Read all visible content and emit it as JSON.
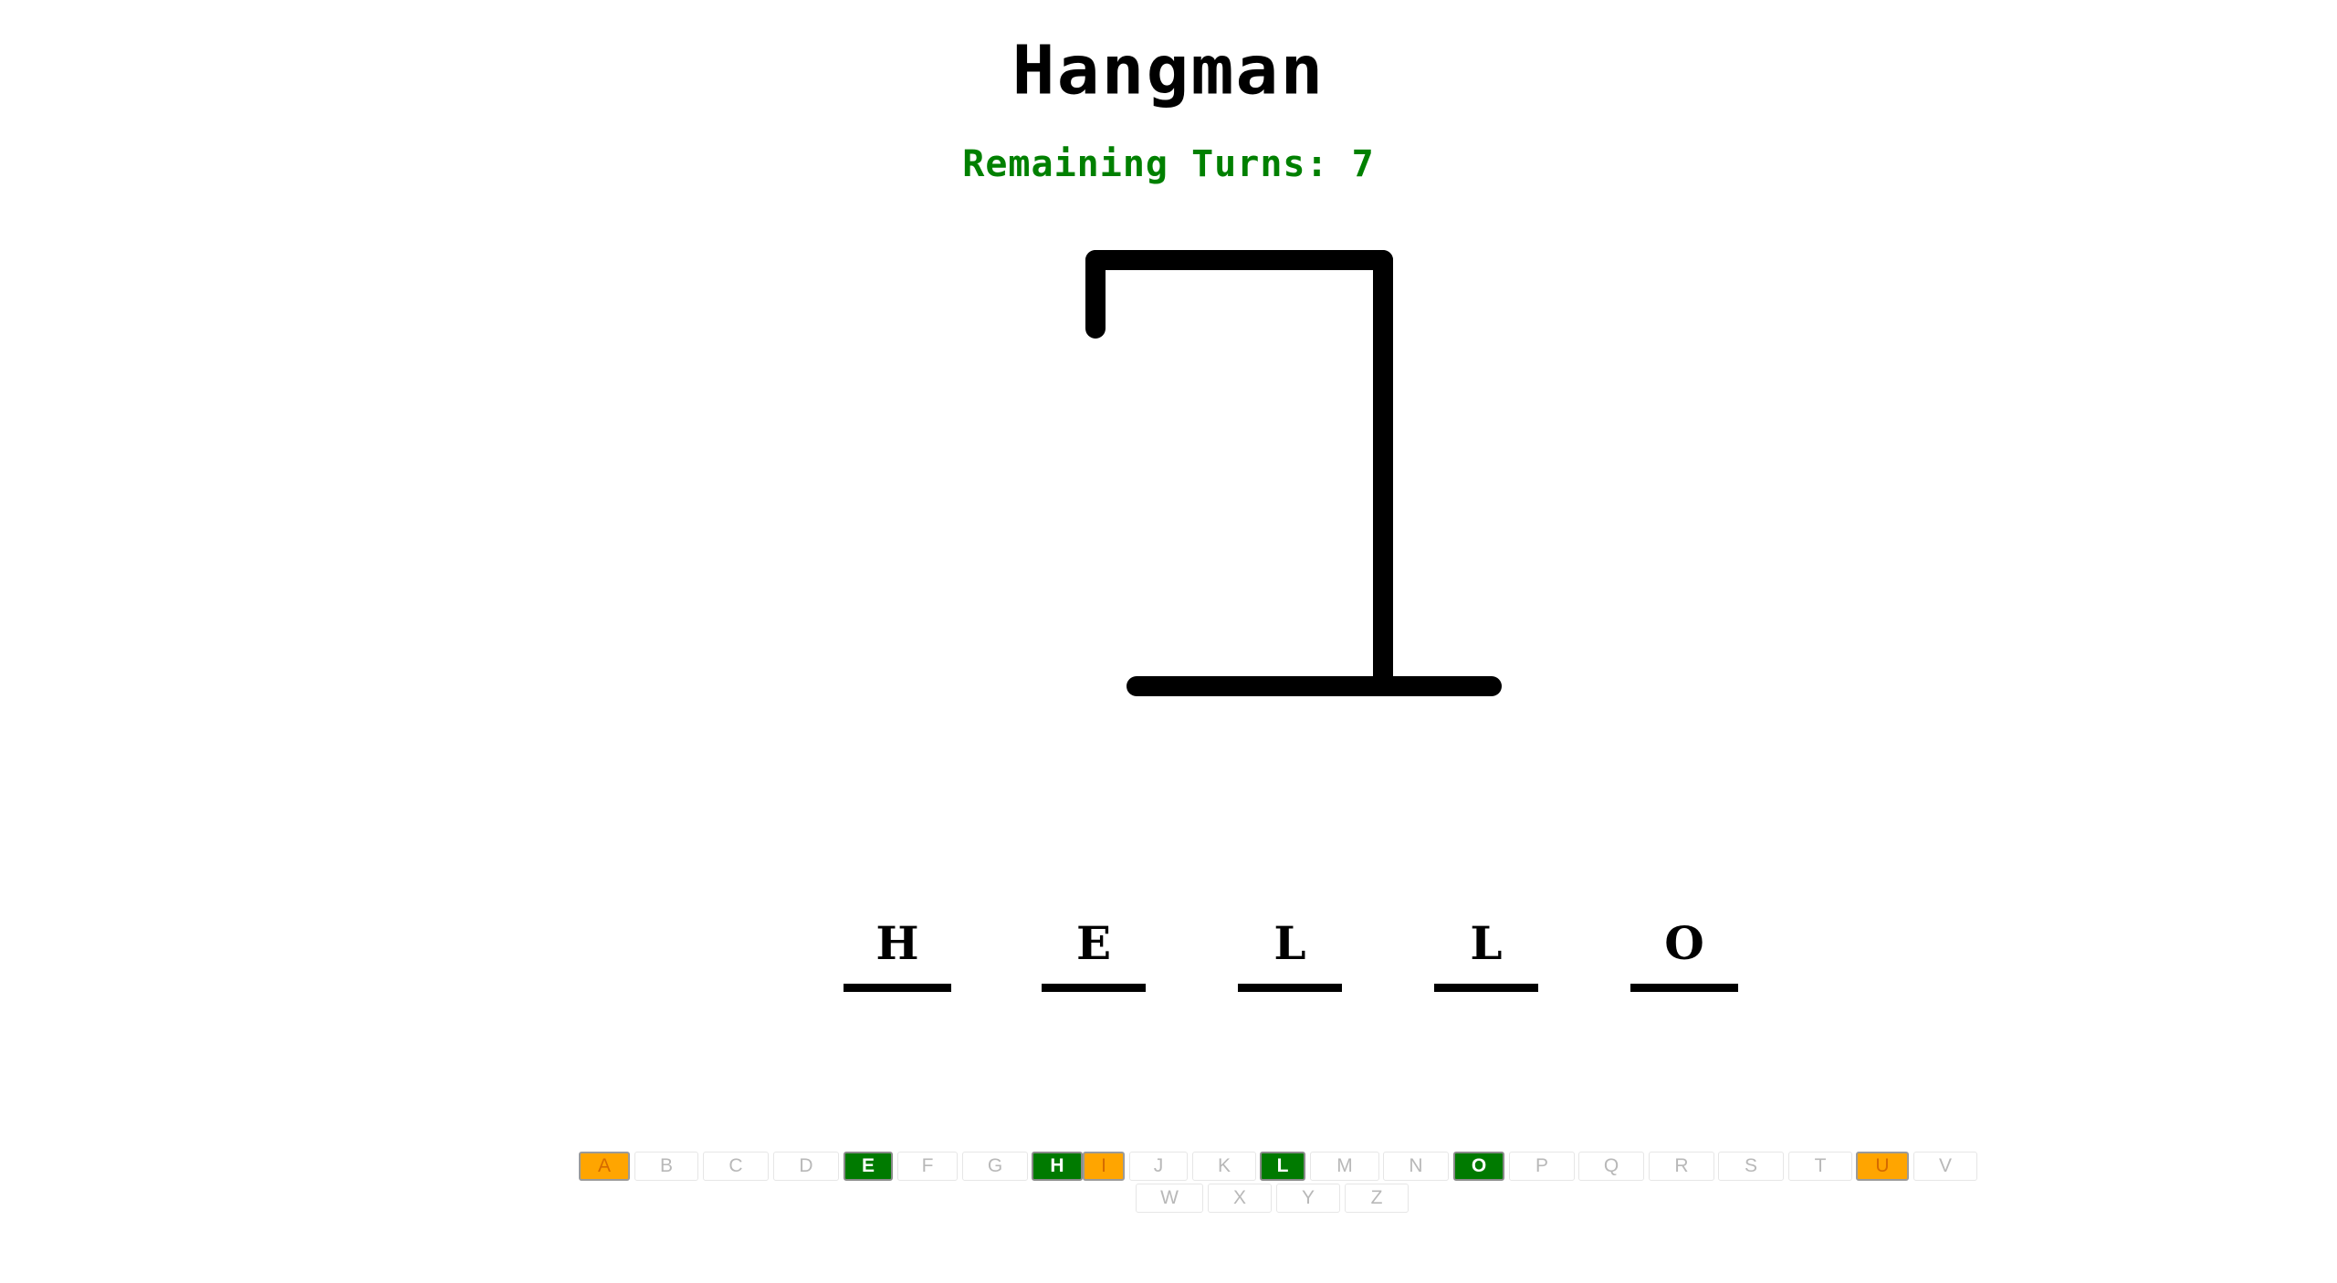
{
  "game": {
    "title": "Hangman",
    "remaining_turns_label": "Remaining Turns: 7",
    "remaining_turns": 7
  },
  "word": {
    "letters": [
      "H",
      "E",
      "L",
      "L",
      "O"
    ]
  },
  "keyboard": {
    "row1": [
      {
        "letter": "A",
        "state": "wrong"
      },
      {
        "letter": "B",
        "state": "unused"
      },
      {
        "letter": "C",
        "state": "unused"
      },
      {
        "letter": "D",
        "state": "unused"
      },
      {
        "letter": "E",
        "state": "correct"
      },
      {
        "letter": "F",
        "state": "unused"
      },
      {
        "letter": "G",
        "state": "unused"
      },
      {
        "letter": "H",
        "state": "correct"
      },
      {
        "letter": "I",
        "state": "wrong"
      },
      {
        "letter": "J",
        "state": "unused"
      },
      {
        "letter": "K",
        "state": "unused"
      },
      {
        "letter": "L",
        "state": "correct"
      },
      {
        "letter": "M",
        "state": "unused"
      },
      {
        "letter": "N",
        "state": "unused"
      },
      {
        "letter": "O",
        "state": "correct"
      },
      {
        "letter": "P",
        "state": "unused"
      },
      {
        "letter": "Q",
        "state": "unused"
      },
      {
        "letter": "R",
        "state": "unused"
      },
      {
        "letter": "S",
        "state": "unused"
      },
      {
        "letter": "T",
        "state": "unused"
      },
      {
        "letter": "U",
        "state": "wrong"
      },
      {
        "letter": "V",
        "state": "unused"
      }
    ],
    "row2": [
      {
        "letter": "W",
        "state": "unused"
      },
      {
        "letter": "X",
        "state": "unused"
      },
      {
        "letter": "Y",
        "state": "unused"
      },
      {
        "letter": "Z",
        "state": "unused"
      }
    ]
  },
  "colors": {
    "correct": "#007a00",
    "wrong": "#ffa500",
    "turns_text": "#008000",
    "ink": "#000000"
  }
}
